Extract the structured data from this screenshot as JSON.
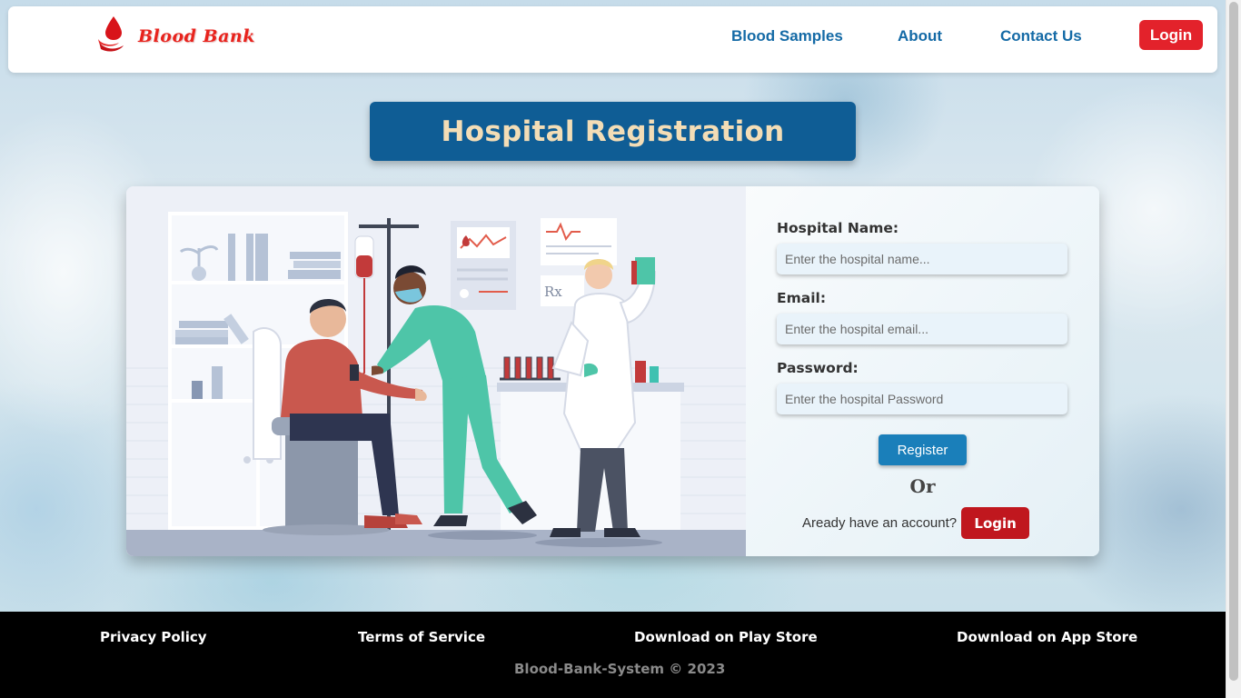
{
  "navbar": {
    "brand": "Blood Bank",
    "links": [
      "Blood Samples",
      "About",
      "Contact Us"
    ],
    "login_label": "Login"
  },
  "page_title": "Hospital Registration",
  "form": {
    "name_label": "Hospital Name:",
    "name_placeholder": "Enter the hospital name...",
    "email_label": "Email:",
    "email_placeholder": "Enter the hospital email...",
    "password_label": "Password:",
    "password_placeholder": "Enter the hospital Password",
    "register_label": "Register",
    "or_text": "Or",
    "already_text": "Aready have an account?",
    "login_label": "Login"
  },
  "illustration": {
    "rx_label": "Rx"
  },
  "footer": {
    "links": [
      "Privacy Policy",
      "Terms of Service",
      "Download on Play Store",
      "Download on App Store"
    ],
    "copyright": "Blood-Bank-System © 2023"
  },
  "colors": {
    "brand_red": "#e8231d",
    "nav_blue": "#146aa6",
    "title_bg": "#0f5d95",
    "title_text": "#f3ddb6",
    "register_blue": "#1a7fba",
    "login_red": "#c0171e"
  }
}
